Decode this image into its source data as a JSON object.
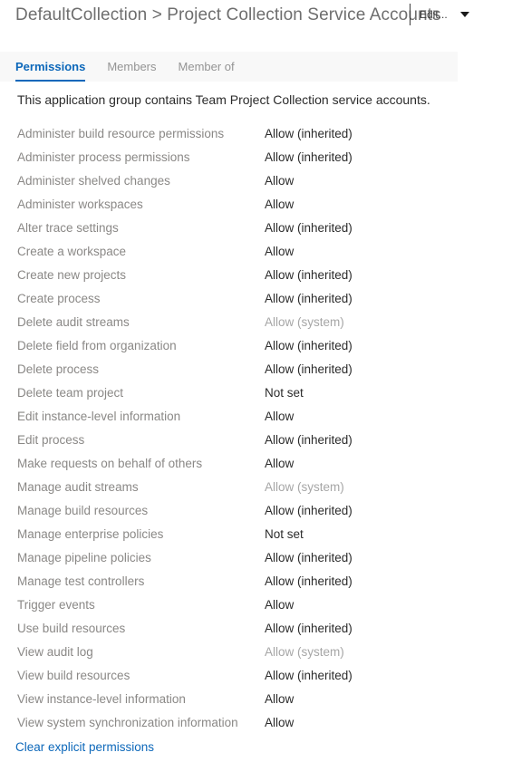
{
  "header": {
    "title": "DefaultCollection > Project Collection Service Accounts",
    "edit_label": "Edit...",
    "chevron_icon": "chevron-down-icon"
  },
  "tabs": [
    {
      "label": "Permissions",
      "active": true
    },
    {
      "label": "Members",
      "active": false
    },
    {
      "label": "Member of",
      "active": false
    }
  ],
  "description": "This application group contains Team Project Collection service accounts.",
  "permissions": [
    {
      "name": "Administer build resource permissions",
      "value": "Allow (inherited)",
      "state": "inherited"
    },
    {
      "name": "Administer process permissions",
      "value": "Allow (inherited)",
      "state": "inherited"
    },
    {
      "name": "Administer shelved changes",
      "value": "Allow",
      "state": "explicit"
    },
    {
      "name": "Administer workspaces",
      "value": "Allow",
      "state": "explicit"
    },
    {
      "name": "Alter trace settings",
      "value": "Allow (inherited)",
      "state": "inherited"
    },
    {
      "name": "Create a workspace",
      "value": "Allow",
      "state": "explicit"
    },
    {
      "name": "Create new projects",
      "value": "Allow (inherited)",
      "state": "inherited"
    },
    {
      "name": "Create process",
      "value": "Allow (inherited)",
      "state": "inherited"
    },
    {
      "name": "Delete audit streams",
      "value": "Allow (system)",
      "state": "system"
    },
    {
      "name": "Delete field from organization",
      "value": "Allow (inherited)",
      "state": "inherited"
    },
    {
      "name": "Delete process",
      "value": "Allow (inherited)",
      "state": "inherited"
    },
    {
      "name": "Delete team project",
      "value": "Not set",
      "state": "notset"
    },
    {
      "name": "Edit instance-level information",
      "value": "Allow",
      "state": "explicit"
    },
    {
      "name": "Edit process",
      "value": "Allow (inherited)",
      "state": "inherited"
    },
    {
      "name": "Make requests on behalf of others",
      "value": "Allow",
      "state": "explicit"
    },
    {
      "name": "Manage audit streams",
      "value": "Allow (system)",
      "state": "system"
    },
    {
      "name": "Manage build resources",
      "value": "Allow (inherited)",
      "state": "inherited"
    },
    {
      "name": "Manage enterprise policies",
      "value": "Not set",
      "state": "notset"
    },
    {
      "name": "Manage pipeline policies",
      "value": "Allow (inherited)",
      "state": "inherited"
    },
    {
      "name": "Manage test controllers",
      "value": "Allow (inherited)",
      "state": "inherited"
    },
    {
      "name": "Trigger events",
      "value": "Allow",
      "state": "explicit"
    },
    {
      "name": "Use build resources",
      "value": "Allow (inherited)",
      "state": "inherited"
    },
    {
      "name": "View audit log",
      "value": "Allow (system)",
      "state": "system"
    },
    {
      "name": "View build resources",
      "value": "Allow (inherited)",
      "state": "inherited"
    },
    {
      "name": "View instance-level information",
      "value": "Allow",
      "state": "explicit"
    },
    {
      "name": "View system synchronization information",
      "value": "Allow",
      "state": "explicit"
    }
  ],
  "footer": {
    "clear_link_label": "Clear explicit permissions"
  },
  "colors": {
    "accent": "#0d68ba",
    "tabbar_background": "#f8f8f8",
    "label_text": "#8a8886",
    "value_text": "#2b2b2b",
    "system_value_text": "#a6a6a6",
    "title_text": "#6e6e6e"
  }
}
